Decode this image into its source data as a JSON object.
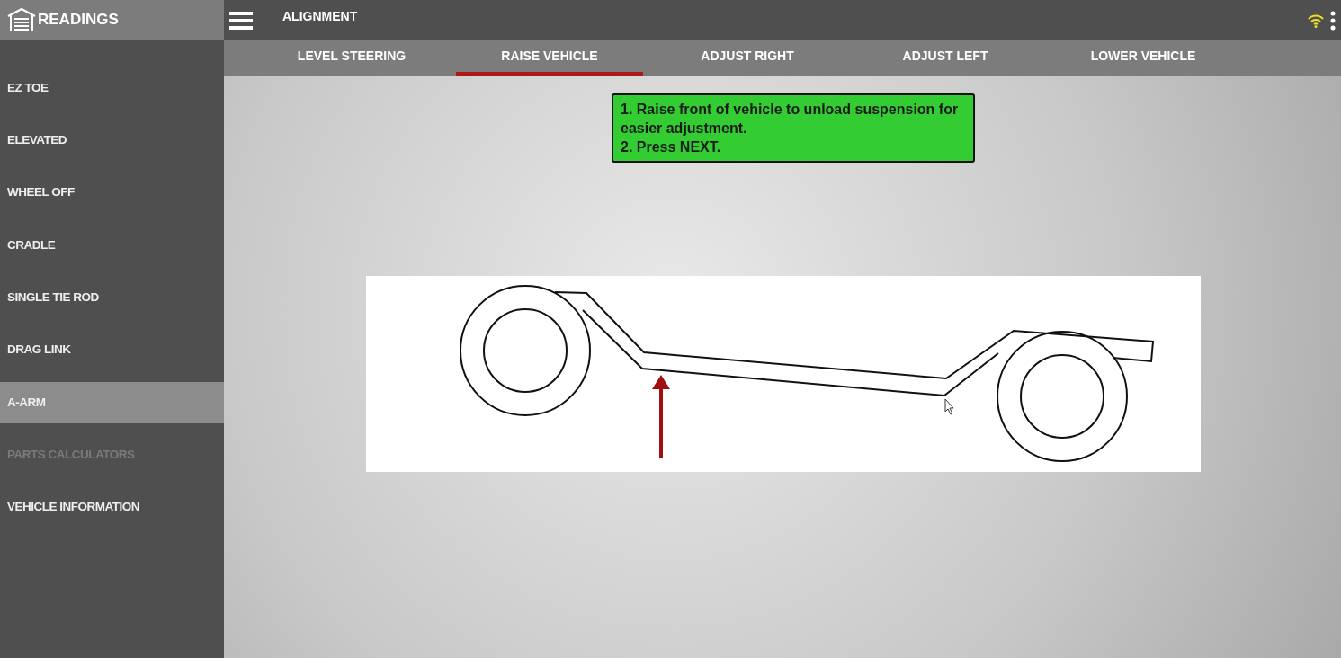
{
  "sidebar": {
    "title": "READINGS",
    "items": [
      {
        "label": "EZ TOE",
        "selected": false,
        "disabled": false
      },
      {
        "label": "ELEVATED",
        "selected": false,
        "disabled": false
      },
      {
        "label": "WHEEL OFF",
        "selected": false,
        "disabled": false
      },
      {
        "label": "CRADLE",
        "selected": false,
        "disabled": false
      },
      {
        "label": "SINGLE TIE ROD",
        "selected": false,
        "disabled": false
      },
      {
        "label": "DRAG LINK",
        "selected": false,
        "disabled": false
      },
      {
        "label": "A-ARM",
        "selected": true,
        "disabled": false
      },
      {
        "label": "PARTS CALCULATORS",
        "selected": false,
        "disabled": true
      },
      {
        "label": "VEHICLE INFORMATION",
        "selected": false,
        "disabled": false
      }
    ]
  },
  "header": {
    "title": "ALIGNMENT"
  },
  "tabs": [
    {
      "label": "LEVEL STEERING",
      "selected": false
    },
    {
      "label": "RAISE VEHICLE",
      "selected": true
    },
    {
      "label": "ADJUST RIGHT",
      "selected": false
    },
    {
      "label": "ADJUST LEFT",
      "selected": false
    },
    {
      "label": "LOWER VEHICLE",
      "selected": false
    }
  ],
  "instructions": [
    "1. Raise front of vehicle to unload suspension for easier adjustment.",
    "2. Press NEXT."
  ]
}
